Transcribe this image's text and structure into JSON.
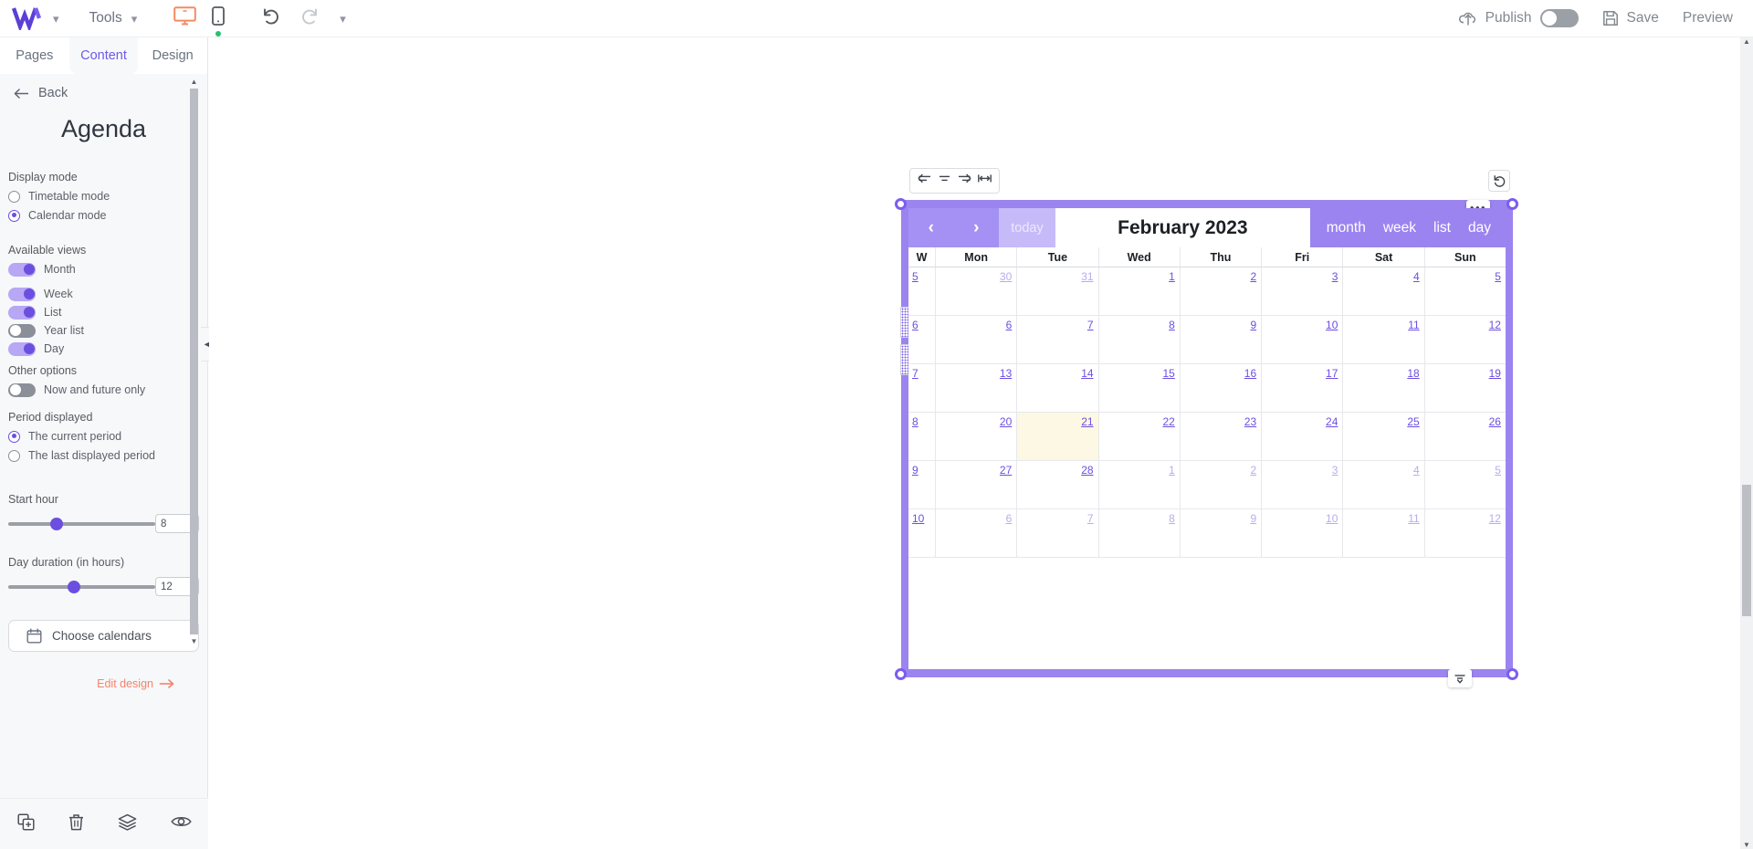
{
  "topbar": {
    "logo_icon": "w-logo-icon",
    "logo_chevron_icon": "chevron-down-icon",
    "tools_label": "Tools",
    "tools_chevron_icon": "chevron-down-icon",
    "desktop_icon": "desktop-monitor-icon",
    "mobile_icon": "mobile-phone-icon",
    "undo_icon": "undo-arrow-icon",
    "redo_icon": "redo-arrow-icon",
    "history_chevron_icon": "chevron-down-icon",
    "publish_label": "Publish",
    "publish_icon": "publish-cloud-upload-icon",
    "publish_toggle_state": "off",
    "save_label": "Save",
    "save_icon": "floppy-disk-icon",
    "preview_label": "Preview",
    "desktop_active_color": "#f58a62",
    "mobile_status_color": "#25c16f"
  },
  "sidebar": {
    "tabs": [
      {
        "label": "Pages",
        "active": false
      },
      {
        "label": "Content",
        "active": true
      },
      {
        "label": "Design",
        "active": false
      }
    ],
    "back_label": "Back",
    "back_icon": "arrow-left-icon",
    "panel_title": "Agenda",
    "display_mode": {
      "label": "Display mode",
      "options": [
        {
          "label": "Timetable mode",
          "selected": false
        },
        {
          "label": "Calendar mode",
          "selected": true
        }
      ]
    },
    "available_views": {
      "label": "Available views",
      "toggles": [
        {
          "label": "Month",
          "state": "on"
        },
        {
          "label": "Week",
          "state": "on"
        },
        {
          "label": "List",
          "state": "on"
        },
        {
          "label": "Year list",
          "state": "off"
        },
        {
          "label": "Day",
          "state": "on"
        }
      ]
    },
    "other_options": {
      "label": "Other options",
      "toggles": [
        {
          "label": "Now and future only",
          "state": "off"
        }
      ]
    },
    "period_displayed": {
      "label": "Period displayed",
      "options": [
        {
          "label": "The current period",
          "selected": true
        },
        {
          "label": "The last displayed period",
          "selected": false
        }
      ]
    },
    "start_hour": {
      "label": "Start hour",
      "value": "8",
      "fill_percent": 33
    },
    "day_duration": {
      "label": "Day duration (in hours)",
      "value": "12",
      "fill_percent": 45
    },
    "choose_calendars": {
      "label": "Choose calendars",
      "icon": "calendar-icon"
    },
    "edit_design": {
      "label": "Edit design",
      "arrow_icon": "arrow-right-icon",
      "color": "#f4846b"
    },
    "bottom_actions": [
      {
        "icon": "duplicate-icon"
      },
      {
        "icon": "trash-icon"
      },
      {
        "icon": "layers-icon"
      },
      {
        "icon": "eye-icon"
      }
    ],
    "collapse_icon": "chevron-left-icon",
    "scroll_up_icon": "caret-up-icon",
    "scroll_down_icon": "caret-down-icon"
  },
  "canvas": {
    "align_toolbar": [
      {
        "icon": "align-left-icon"
      },
      {
        "icon": "align-center-icon"
      },
      {
        "icon": "align-right-icon"
      },
      {
        "icon": "fit-width-icon"
      }
    ],
    "reset_icon": "reset-rotate-icon",
    "overflow_menu_label": "•••",
    "bottom_grip_icon": "resize-vertical-icon",
    "selection_color": "#9b84f0",
    "scroll_up_icon": "caret-up-icon",
    "scroll_down_icon": "caret-down-icon"
  },
  "calendar": {
    "prev_icon": "chevron-left-icon",
    "next_icon": "chevron-right-icon",
    "today_label": "today",
    "title": "February 2023",
    "views": [
      {
        "label": "month"
      },
      {
        "label": "week"
      },
      {
        "label": "list"
      },
      {
        "label": "day"
      }
    ],
    "column_headers": [
      "W",
      "Mon",
      "Tue",
      "Wed",
      "Thu",
      "Fri",
      "Sat",
      "Sun"
    ],
    "header_color": "#9b84f0",
    "today_cell_color": "#fcf8e3",
    "weeks": [
      {
        "week": "5",
        "days": [
          {
            "n": "30",
            "muted": true,
            "today": false
          },
          {
            "n": "31",
            "muted": true,
            "today": false
          },
          {
            "n": "1",
            "muted": false,
            "today": false
          },
          {
            "n": "2",
            "muted": false,
            "today": false
          },
          {
            "n": "3",
            "muted": false,
            "today": false
          },
          {
            "n": "4",
            "muted": false,
            "today": false
          },
          {
            "n": "5",
            "muted": false,
            "today": false
          }
        ]
      },
      {
        "week": "6",
        "days": [
          {
            "n": "6",
            "muted": false,
            "today": false
          },
          {
            "n": "7",
            "muted": false,
            "today": false
          },
          {
            "n": "8",
            "muted": false,
            "today": false
          },
          {
            "n": "9",
            "muted": false,
            "today": false
          },
          {
            "n": "10",
            "muted": false,
            "today": false
          },
          {
            "n": "11",
            "muted": false,
            "today": false
          },
          {
            "n": "12",
            "muted": false,
            "today": false
          }
        ]
      },
      {
        "week": "7",
        "days": [
          {
            "n": "13",
            "muted": false,
            "today": false
          },
          {
            "n": "14",
            "muted": false,
            "today": false
          },
          {
            "n": "15",
            "muted": false,
            "today": false
          },
          {
            "n": "16",
            "muted": false,
            "today": false
          },
          {
            "n": "17",
            "muted": false,
            "today": false
          },
          {
            "n": "18",
            "muted": false,
            "today": false
          },
          {
            "n": "19",
            "muted": false,
            "today": false
          }
        ]
      },
      {
        "week": "8",
        "days": [
          {
            "n": "20",
            "muted": false,
            "today": false
          },
          {
            "n": "21",
            "muted": false,
            "today": true
          },
          {
            "n": "22",
            "muted": false,
            "today": false
          },
          {
            "n": "23",
            "muted": false,
            "today": false
          },
          {
            "n": "24",
            "muted": false,
            "today": false
          },
          {
            "n": "25",
            "muted": false,
            "today": false
          },
          {
            "n": "26",
            "muted": false,
            "today": false
          }
        ]
      },
      {
        "week": "9",
        "days": [
          {
            "n": "27",
            "muted": false,
            "today": false
          },
          {
            "n": "28",
            "muted": false,
            "today": false
          },
          {
            "n": "1",
            "muted": true,
            "today": false
          },
          {
            "n": "2",
            "muted": true,
            "today": false
          },
          {
            "n": "3",
            "muted": true,
            "today": false
          },
          {
            "n": "4",
            "muted": true,
            "today": false
          },
          {
            "n": "5",
            "muted": true,
            "today": false
          }
        ]
      },
      {
        "week": "10",
        "days": [
          {
            "n": "6",
            "muted": true,
            "today": false
          },
          {
            "n": "7",
            "muted": true,
            "today": false
          },
          {
            "n": "8",
            "muted": true,
            "today": false
          },
          {
            "n": "9",
            "muted": true,
            "today": false
          },
          {
            "n": "10",
            "muted": true,
            "today": false
          },
          {
            "n": "11",
            "muted": true,
            "today": false
          },
          {
            "n": "12",
            "muted": true,
            "today": false
          }
        ]
      }
    ]
  }
}
